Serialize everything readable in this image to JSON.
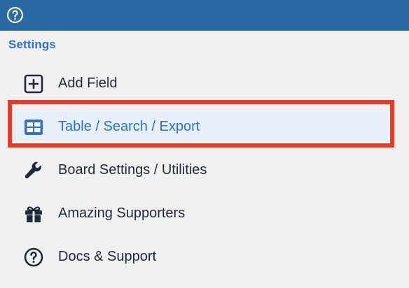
{
  "header": {
    "help_icon": "help-circle-icon",
    "bar_color": "#2a6aa4"
  },
  "sidebar": {
    "section_title": "Settings",
    "items": [
      {
        "label": "Add Field",
        "icon": "plus-square-icon",
        "active": false
      },
      {
        "label": "Table / Search / Export",
        "icon": "table-icon",
        "active": true
      },
      {
        "label": "Board Settings / Utilities",
        "icon": "wrench-icon",
        "active": false
      },
      {
        "label": "Amazing Supporters",
        "icon": "gift-icon",
        "active": false
      },
      {
        "label": "Docs & Support",
        "icon": "help-circle-icon",
        "active": false
      }
    ]
  },
  "colors": {
    "accent": "#2f6fd3",
    "text": "#1f2a3a",
    "active_bg": "#e7effb",
    "highlight_border": "#ee3a22",
    "page_bg": "#f0f0f1"
  }
}
